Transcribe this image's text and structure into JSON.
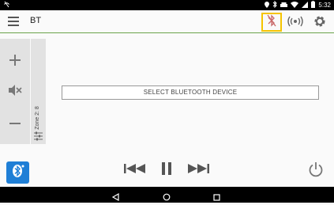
{
  "status_bar": {
    "time": "5:32",
    "icons": [
      "no-notification-icon",
      "location-icon",
      "bluetooth-icon",
      "car-icon",
      "wifi-icon",
      "signal-icon",
      "battery-icon"
    ]
  },
  "app_bar": {
    "title": "BT",
    "icons": [
      "menu-icon",
      "bluetooth-disabled-icon",
      "broadcast-icon",
      "gear-icon"
    ],
    "highlight_color": "#f5c400",
    "accent_line_color": "#6aa34a"
  },
  "zone_panel": {
    "zone_label": "Zone 2: 8",
    "controls": [
      "volume-up-icon",
      "mute-icon",
      "volume-down-icon",
      "equalizer-icon"
    ]
  },
  "main": {
    "select_device_label": "SELECT BLUETOOTH DEVICE"
  },
  "bottom_bar": {
    "source_color": "#1f7fd6",
    "controls": [
      "bluetooth-source-icon",
      "previous-icon",
      "pause-icon",
      "next-icon",
      "power-icon"
    ]
  },
  "nav_bar": {
    "buttons": [
      "back-icon",
      "home-icon",
      "recents-icon"
    ]
  }
}
